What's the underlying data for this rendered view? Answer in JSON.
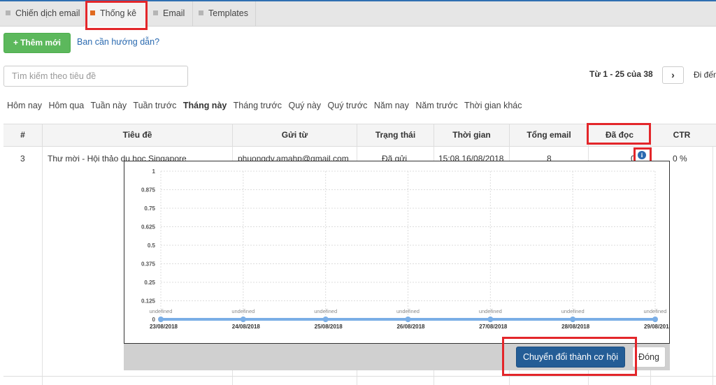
{
  "tabs": [
    {
      "label": "Chiến dịch email",
      "active": false
    },
    {
      "label": "Thống kê",
      "active": true
    },
    {
      "label": "Email",
      "active": false
    },
    {
      "label": "Templates",
      "active": false
    }
  ],
  "toolbar": {
    "add_label": "Thêm mới",
    "help_link": "Ban cần hướng dẫn?"
  },
  "search": {
    "placeholder": "Tìm kiếm theo tiêu đề"
  },
  "pager": {
    "range_label": "Từ 1 - 25 của 38",
    "next_symbol": "›",
    "goto_label": "Đi đến"
  },
  "date_filters": [
    "Hôm nay",
    "Hôm qua",
    "Tuần này",
    "Tuần trước",
    "Tháng này",
    "Tháng trước",
    "Quý này",
    "Quý trước",
    "Năm nay",
    "Năm trước",
    "Thời gian khác"
  ],
  "active_date_filter": "Tháng này",
  "table": {
    "columns": [
      "#",
      "Tiêu đề",
      "Gửi từ",
      "Trạng thái",
      "Thời gian",
      "Tổng email",
      "Đã đọc",
      "CTR"
    ],
    "rows": [
      {
        "id": "3",
        "title": "Thư mời - Hội thảo du học Singapore",
        "from": "phuongdv.amahp@gmail.com",
        "status": "Đã gửi",
        "time": "15:08 16/08/2018",
        "total": "8",
        "read": "0",
        "ctr": "0 %"
      }
    ]
  },
  "popup": {
    "convert_label": "Chuyển đổi thành cơ hội",
    "close_label": "Đóng"
  },
  "chart_data": {
    "type": "line",
    "x": [
      "23/08/2018",
      "24/08/2018",
      "25/08/2018",
      "26/08/2018",
      "27/08/2018",
      "28/08/2018",
      "29/08/2018"
    ],
    "series": [
      {
        "values": [
          0,
          0,
          0,
          0,
          0,
          0,
          0
        ]
      }
    ],
    "point_labels": [
      "undefined",
      "undefined",
      "undefined",
      "undefined",
      "undefined",
      "undefined",
      "undefined"
    ],
    "y_ticks": [
      "0",
      "0.125",
      "0.25",
      "0.375",
      "0.5",
      "0.625",
      "0.75",
      "0.875",
      "1"
    ],
    "ylim": [
      0,
      1
    ],
    "grid": true,
    "line_color": "#7aaee6"
  },
  "colors": {
    "accent": "#2f6fb2",
    "add_button": "#5cb85c",
    "convert_button": "#245d96",
    "highlight": "#e3262a",
    "active_tab_marker": "#e06a1f"
  }
}
